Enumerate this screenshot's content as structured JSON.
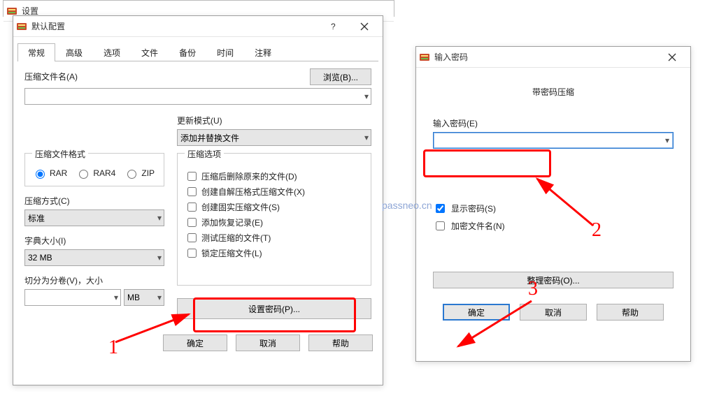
{
  "behind_window": {
    "title": "设置"
  },
  "dialog1": {
    "title": "默认配置",
    "tabs": [
      "常规",
      "高级",
      "选项",
      "文件",
      "备份",
      "时间",
      "注释"
    ],
    "active_tab_index": 0,
    "archive_name_label": "压缩文件名(A)",
    "browse_btn": "浏览(B)...",
    "update_mode_label": "更新模式(U)",
    "update_mode_value": "添加并替换文件",
    "format_group": "压缩文件格式",
    "formats": {
      "rar": "RAR",
      "rar4": "RAR4",
      "zip": "ZIP"
    },
    "format_selected": "rar",
    "method_label": "压缩方式(C)",
    "method_value": "标准",
    "dict_label": "字典大小(I)",
    "dict_value": "32 MB",
    "split_label": "切分为分卷(V)，大小",
    "split_unit": "MB",
    "options_group": "压缩选项",
    "options": [
      "压缩后删除原来的文件(D)",
      "创建自解压格式压缩文件(X)",
      "创建固实压缩文件(S)",
      "添加恢复记录(E)",
      "测试压缩的文件(T)",
      "锁定压缩文件(L)"
    ],
    "set_password_btn": "设置密码(P)...",
    "ok": "确定",
    "cancel": "取消",
    "help": "帮助"
  },
  "dialog2": {
    "title": "输入密码",
    "heading": "带密码压缩",
    "password_label": "输入密码(E)",
    "show_password": "显示密码(S)",
    "show_password_checked": true,
    "encrypt_names": "加密文件名(N)",
    "encrypt_names_checked": false,
    "organize_btn": "整理密码(O)...",
    "ok": "确定",
    "cancel": "取消",
    "help": "帮助"
  },
  "annotations": {
    "n1": "1",
    "n2": "2",
    "n3": "3",
    "watermark": "passneo.cn"
  }
}
